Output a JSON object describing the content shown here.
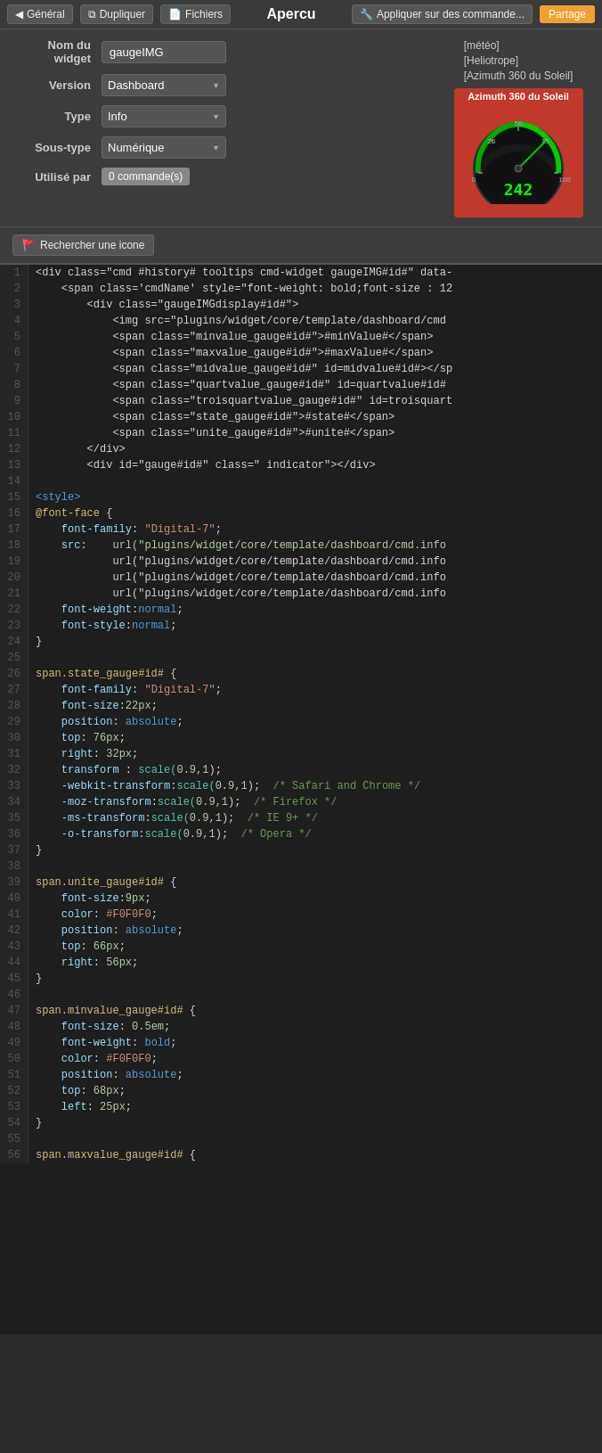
{
  "toolbar": {
    "back_label": "Général",
    "duplicate_label": "Dupliquer",
    "files_label": "Fichiers",
    "title": "Apercu",
    "apply_label": "Appliquer sur des commande...",
    "share_label": "Partage"
  },
  "form": {
    "widget_name_label": "Nom du widget",
    "widget_name_value": "gaugeIMG",
    "version_label": "Version",
    "version_value": "Dashboard",
    "type_label": "Type",
    "type_value": "Info",
    "subtype_label": "Sous-type",
    "subtype_value": "Numérique",
    "used_by_label": "Utilisé par",
    "used_by_badge": "0 commande(s)"
  },
  "preview": {
    "label_lines": [
      "[météo]",
      "[Heliotrope]",
      "[Azimuth 360 du Soleil]"
    ],
    "gauge_title": "Azimuth 360 du Soleil",
    "gauge_value": "242"
  },
  "icon_search": {
    "button_label": "Rechercher une icone"
  },
  "code": {
    "lines": [
      {
        "num": 1,
        "content": "<div class=\"cmd #history# tooltips cmd-widget gaugeIMG#id#\" data-"
      },
      {
        "num": 2,
        "content": "    <span class='cmdName' style=\"font-weight: bold;font-size : 12"
      },
      {
        "num": 3,
        "content": "        <div class=\"gaugeIMGdisplay#id#\">"
      },
      {
        "num": 4,
        "content": "            <img src=\"plugins/widget/core/template/dashboard/cmd"
      },
      {
        "num": 5,
        "content": "            <span class=\"minvalue_gauge#id#\">#minValue#</span>"
      },
      {
        "num": 6,
        "content": "            <span class=\"maxvalue_gauge#id#\">#maxValue#</span>"
      },
      {
        "num": 7,
        "content": "            <span class=\"midvalue_gauge#id#\" id=midvalue#id#></sp"
      },
      {
        "num": 8,
        "content": "            <span class=\"quartvalue_gauge#id#\" id=quartvalue#id#"
      },
      {
        "num": 9,
        "content": "            <span class=\"troisquartvalue_gauge#id#\" id=troisquart"
      },
      {
        "num": 10,
        "content": "            <span class=\"state_gauge#id#\">#state#</span>"
      },
      {
        "num": 11,
        "content": "            <span class=\"unite_gauge#id#\">#unite#</span>"
      },
      {
        "num": 12,
        "content": "        </div>"
      },
      {
        "num": 13,
        "content": "        <div id=\"gauge#id#\" class=\" indicator\"></div>"
      },
      {
        "num": 14,
        "content": ""
      },
      {
        "num": 15,
        "content": "<style>"
      },
      {
        "num": 16,
        "content": "@font-face {"
      },
      {
        "num": 17,
        "content": "    font-family: \"Digital-7\";"
      },
      {
        "num": 18,
        "content": "    src:    url(\"plugins/widget/core/template/dashboard/cmd.info"
      },
      {
        "num": 19,
        "content": "            url(\"plugins/widget/core/template/dashboard/cmd.info"
      },
      {
        "num": 20,
        "content": "            url(\"plugins/widget/core/template/dashboard/cmd.info"
      },
      {
        "num": 21,
        "content": "            url(\"plugins/widget/core/template/dashboard/cmd.info"
      },
      {
        "num": 22,
        "content": "    font-weight:normal;"
      },
      {
        "num": 23,
        "content": "    font-style:normal;"
      },
      {
        "num": 24,
        "content": "}"
      },
      {
        "num": 25,
        "content": ""
      },
      {
        "num": 26,
        "content": "span.state_gauge#id# {"
      },
      {
        "num": 27,
        "content": "    font-family: \"Digital-7\";"
      },
      {
        "num": 28,
        "content": "    font-size:22px;"
      },
      {
        "num": 29,
        "content": "    position: absolute;"
      },
      {
        "num": 30,
        "content": "    top: 76px;"
      },
      {
        "num": 31,
        "content": "    right: 32px;"
      },
      {
        "num": 32,
        "content": "    transform : scale(0.9,1);"
      },
      {
        "num": 33,
        "content": "    -webkit-transform:scale(0.9,1); /* Safari and Chrome */"
      },
      {
        "num": 34,
        "content": "    -moz-transform:scale(0.9,1); /* Firefox */"
      },
      {
        "num": 35,
        "content": "    -ms-transform:scale(0.9,1); /* IE 9+ */"
      },
      {
        "num": 36,
        "content": "    -o-transform:scale(0.9,1); /* Opera */"
      },
      {
        "num": 37,
        "content": "}"
      },
      {
        "num": 38,
        "content": ""
      },
      {
        "num": 39,
        "content": "span.unite_gauge#id# {"
      },
      {
        "num": 40,
        "content": "    font-size:9px;"
      },
      {
        "num": 41,
        "content": "    color: #F0F0F0;"
      },
      {
        "num": 42,
        "content": "    position: absolute;"
      },
      {
        "num": 43,
        "content": "    top: 66px;"
      },
      {
        "num": 44,
        "content": "    right: 56px;"
      },
      {
        "num": 45,
        "content": "}"
      },
      {
        "num": 46,
        "content": ""
      },
      {
        "num": 47,
        "content": "span.minvalue_gauge#id# {"
      },
      {
        "num": 48,
        "content": "    font-size: 0.5em;"
      },
      {
        "num": 49,
        "content": "    font-weight: bold;"
      },
      {
        "num": 50,
        "content": "    color: #F0F0F0;"
      },
      {
        "num": 51,
        "content": "    position: absolute;"
      },
      {
        "num": 52,
        "content": "    top: 68px;"
      },
      {
        "num": 53,
        "content": "    left: 25px;"
      },
      {
        "num": 54,
        "content": "}"
      },
      {
        "num": 55,
        "content": ""
      },
      {
        "num": 56,
        "content": "span.maxvalue_gauge#id# {"
      }
    ]
  }
}
